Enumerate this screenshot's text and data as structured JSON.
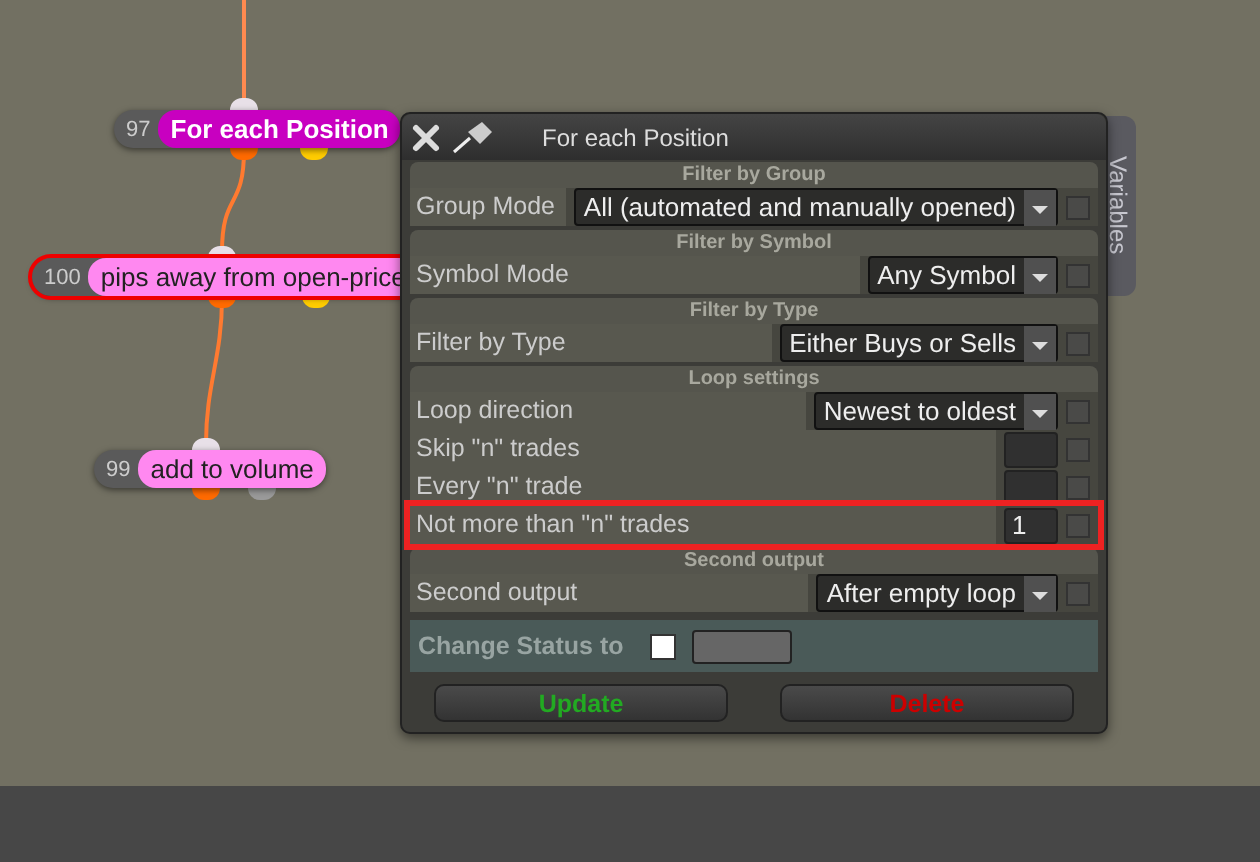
{
  "nodes": [
    {
      "number": "97",
      "label": "For each Position",
      "color": "#c800c0",
      "selected": false,
      "outputs": [
        {
          "color": "#ff6a00"
        },
        {
          "color": "#ffcc00"
        }
      ]
    },
    {
      "number": "100",
      "label": "pips away from open-price",
      "color": "#ff88f0",
      "selected": true,
      "outputs": [
        {
          "color": "#ff6a00"
        },
        {
          "color": "#ffcc00"
        }
      ]
    },
    {
      "number": "99",
      "label": "add to volume",
      "color": "#ff88f0",
      "selected": false,
      "outputs": [
        {
          "color": "#ff6a00"
        },
        {
          "color": "#9a9a9a"
        }
      ]
    }
  ],
  "dialog": {
    "title": "For each Position",
    "side_tab": "Variables",
    "sections": [
      {
        "title": "Filter by Group",
        "rows": [
          {
            "label": "Group Mode",
            "kind": "dropdown",
            "value": "All (automated and manually opened)",
            "checked": false,
            "highlighted": false
          }
        ]
      },
      {
        "title": "Filter by Symbol",
        "rows": [
          {
            "label": "Symbol Mode",
            "kind": "dropdown",
            "value": "Any Symbol",
            "checked": false,
            "highlighted": false
          }
        ]
      },
      {
        "title": "Filter by Type",
        "rows": [
          {
            "label": "Filter by Type",
            "kind": "dropdown",
            "value": "Either Buys or Sells",
            "checked": false,
            "highlighted": false
          }
        ]
      },
      {
        "title": "Loop settings",
        "rows": [
          {
            "label": "Loop direction",
            "kind": "dropdown",
            "value": "Newest to oldest",
            "checked": false,
            "highlighted": false
          },
          {
            "label": "Skip \"n\" trades",
            "kind": "number",
            "checked": false,
            "highlighted": false
          },
          {
            "label": "Every \"n\" trade",
            "kind": "number",
            "checked": false,
            "highlighted": false
          },
          {
            "label": "Not more than \"n\" trades",
            "kind": "number",
            "value": "1",
            "checked": false,
            "highlighted": true
          }
        ]
      },
      {
        "title": "Second output",
        "rows": [
          {
            "label": "Second output",
            "kind": "dropdown",
            "value": "After empty loop",
            "checked": false,
            "highlighted": false
          }
        ]
      }
    ],
    "status": {
      "label": "Change Status to",
      "checked": false
    },
    "buttons": [
      {
        "label": "Update",
        "color": "#22aa22"
      },
      {
        "label": "Delete",
        "color": "#cc0000"
      }
    ]
  }
}
